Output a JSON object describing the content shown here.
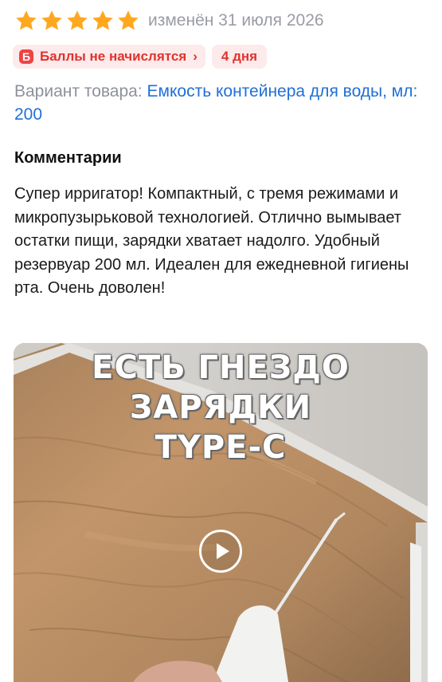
{
  "review": {
    "rating": 5,
    "rating_max": 5,
    "star_color": "#ffa81f",
    "date": "изменён 31 июля 2026"
  },
  "points": {
    "icon_letter": "Б",
    "label": "Баллы не начислятся",
    "chevron": "›",
    "days": "4 дня"
  },
  "variant": {
    "label": "Вариант товара:",
    "value": "Емкость контейнера для воды, мл: 200"
  },
  "comments": {
    "title": "Комментарии",
    "text": "Супер ирригатор! Компактный, с тремя режимами и микропузырьковой технологией. Отлично вымывает остатки пищи, зарядки хватает надолго. Удобный резервуар 200 мл. Идеален для ежедневной гигиены рта. Очень доволен!"
  },
  "video": {
    "overlay_lines": [
      "ЕСТЬ ГНЕЗДО",
      "ЗАРЯДКИ",
      "TYPE-C"
    ],
    "play_icon": "play-icon"
  }
}
